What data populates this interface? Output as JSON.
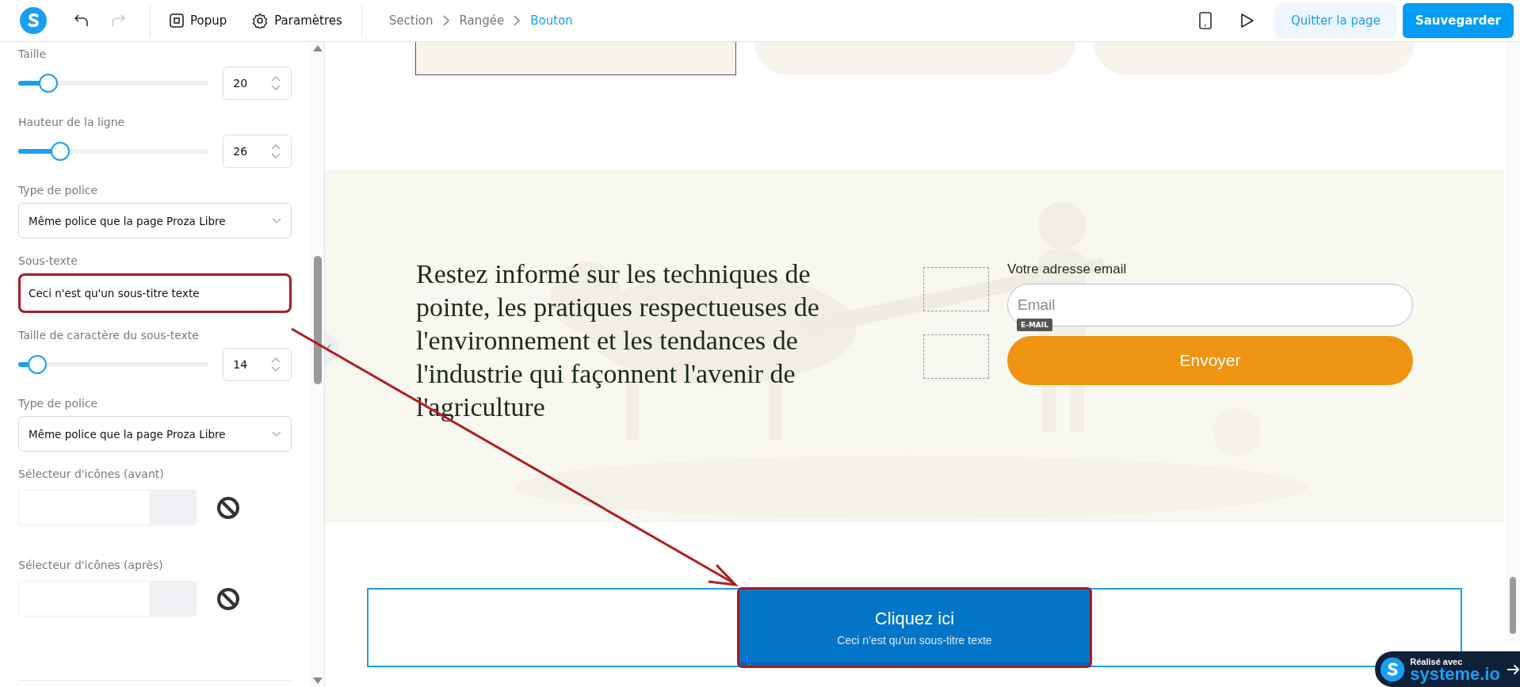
{
  "toolbar": {
    "undo": {
      "disabled": false
    },
    "redo": {
      "disabled": true
    },
    "popup_label": "Popup",
    "settings_label": "Paramètres",
    "breadcrumb": [
      {
        "label": "Section",
        "selected": false
      },
      {
        "label": "Rangée",
        "selected": false
      },
      {
        "label": "Bouton",
        "selected": true
      }
    ],
    "quit_label": "Quitter la page",
    "save_label": "Sauvegarder"
  },
  "panel": {
    "controls": [
      {
        "kind": "slider",
        "label": "Taille",
        "value": "20",
        "level": 0.16
      },
      {
        "kind": "slider",
        "label": "Hauteur de la ligne",
        "value": "26",
        "level": 0.22
      },
      {
        "kind": "select",
        "label": "Type de police",
        "value": "Même police que la page Proza Libre"
      },
      {
        "kind": "text",
        "label": "Sous-texte",
        "value": "Ceci n'est qu'un sous-titre texte",
        "highlighted": true
      },
      {
        "kind": "slider",
        "label": "Taille de caractère du sous-texte",
        "value": "14",
        "level": 0.1
      },
      {
        "kind": "select",
        "label": "Type de police",
        "value": "Même police que la page Proza Libre"
      },
      {
        "kind": "icon_picker",
        "label": "Sélecteur d'icônes (avant)"
      },
      {
        "kind": "icon_picker",
        "label": "Sélecteur d'icônes (après)"
      }
    ]
  },
  "canvas": {
    "cards": [
      {
        "selected": true
      },
      {
        "selected": false
      },
      {
        "selected": false
      }
    ],
    "newsletter": {
      "heading": "Restez informé sur les techniques de pointe, les pratiques respectueuses de l'environnement et les tendances de l'industrie qui façonnent l'avenir de l'agriculture",
      "email_label": "Votre adresse email",
      "email_placeholder": "Email",
      "field_tag": "E-MAIL",
      "submit_label": "Envoyer"
    },
    "cta": {
      "title": "Cliquez ici",
      "subtitle": "Ceci n’est qu’un sous-titre texte",
      "highlighted": true
    }
  },
  "badge": {
    "caption": "Réalisé avec",
    "brand": "systeme.io"
  }
}
